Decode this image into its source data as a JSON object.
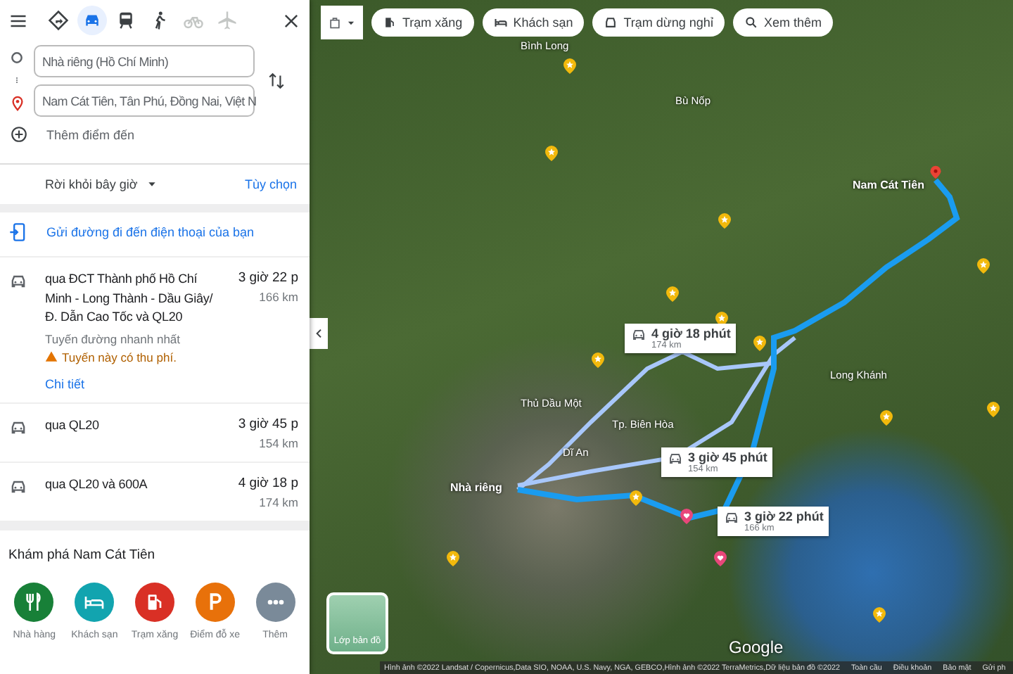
{
  "travel_modes": [
    {
      "kind": "best",
      "selected": false,
      "disabled": false
    },
    {
      "kind": "car",
      "selected": true,
      "disabled": false
    },
    {
      "kind": "transit",
      "selected": false,
      "disabled": false
    },
    {
      "kind": "walk",
      "selected": false,
      "disabled": false
    },
    {
      "kind": "bike",
      "selected": false,
      "disabled": true
    },
    {
      "kind": "flight",
      "selected": false,
      "disabled": true
    }
  ],
  "origin": {
    "value": "Nhà riêng (Hồ Chí Minh)"
  },
  "destination": {
    "value": "Nam Cát Tiên, Tân Phú, Đồng Nai, Việt N"
  },
  "add_destination": "Thêm điểm đến",
  "depart": "Rời khỏi bây giờ",
  "options_link": "Tùy chọn",
  "send_to_phone": "Gửi đường đi đến điện thoại của bạn",
  "routes": [
    {
      "via": "qua ĐCT Thành phố Hồ Chí Minh - Long Thành - Dầu Giây/ Đ. Dẫn Cao Tốc và QL20",
      "time": "3 giờ 22 p",
      "distance": "166 km",
      "note": "Tuyến đường nhanh nhất",
      "warning": "Tuyến này có thu phí.",
      "details_link": "Chi tiết"
    },
    {
      "via": "qua QL20",
      "time": "3 giờ 45 p",
      "distance": "154 km"
    },
    {
      "via": "qua QL20 và 600A",
      "time": "4 giờ 18 p",
      "distance": "174 km"
    }
  ],
  "explore": {
    "title": "Khám phá Nam Cát Tiên",
    "items": [
      {
        "kind": "restaurant",
        "label": "Nhà hàng",
        "color": "#188038"
      },
      {
        "kind": "hotel",
        "label": "Khách sạn",
        "color": "#12a4af"
      },
      {
        "kind": "gas",
        "label": "Trạm xăng",
        "color": "#d93025"
      },
      {
        "kind": "parking",
        "label": "Điểm đỗ xe",
        "color": "#e8710a"
      },
      {
        "kind": "more",
        "label": "Thêm",
        "color": "#7a8a99"
      }
    ]
  },
  "map": {
    "chips": [
      {
        "kind": "gas",
        "label": "Trạm xăng"
      },
      {
        "kind": "hotel",
        "label": "Khách sạn"
      },
      {
        "kind": "rest",
        "label": "Trạm dừng nghỉ"
      },
      {
        "kind": "search",
        "label": "Xem thêm"
      }
    ],
    "labels": [
      "Bình Long",
      "Bù Nốp",
      "Thủ Dầu Một",
      "Tp. Biên Hòa",
      "Dĩ An",
      "Long Khánh"
    ],
    "origin_label": "Nhà riêng",
    "destination_label": "Nam Cát Tiên",
    "callouts": [
      {
        "time": "4 giờ 18 phút",
        "distance": "174 km"
      },
      {
        "time": "3 giờ 45 phút",
        "distance": "154 km"
      },
      {
        "time": "3 giờ 22 phút",
        "distance": "166 km"
      }
    ],
    "layers_button": "Lớp bản đồ",
    "logo": "Google",
    "attribution": "Hình ảnh ©2022 Landsat / Copernicus,Data SIO, NOAA, U.S. Navy, NGA, GEBCO,Hình ảnh ©2022 TerraMetrics,Dữ liệu bản đồ ©2022",
    "footer_links": [
      "Toàn cầu",
      "Điều khoản",
      "Bảo mật",
      "Gửi ph"
    ]
  }
}
